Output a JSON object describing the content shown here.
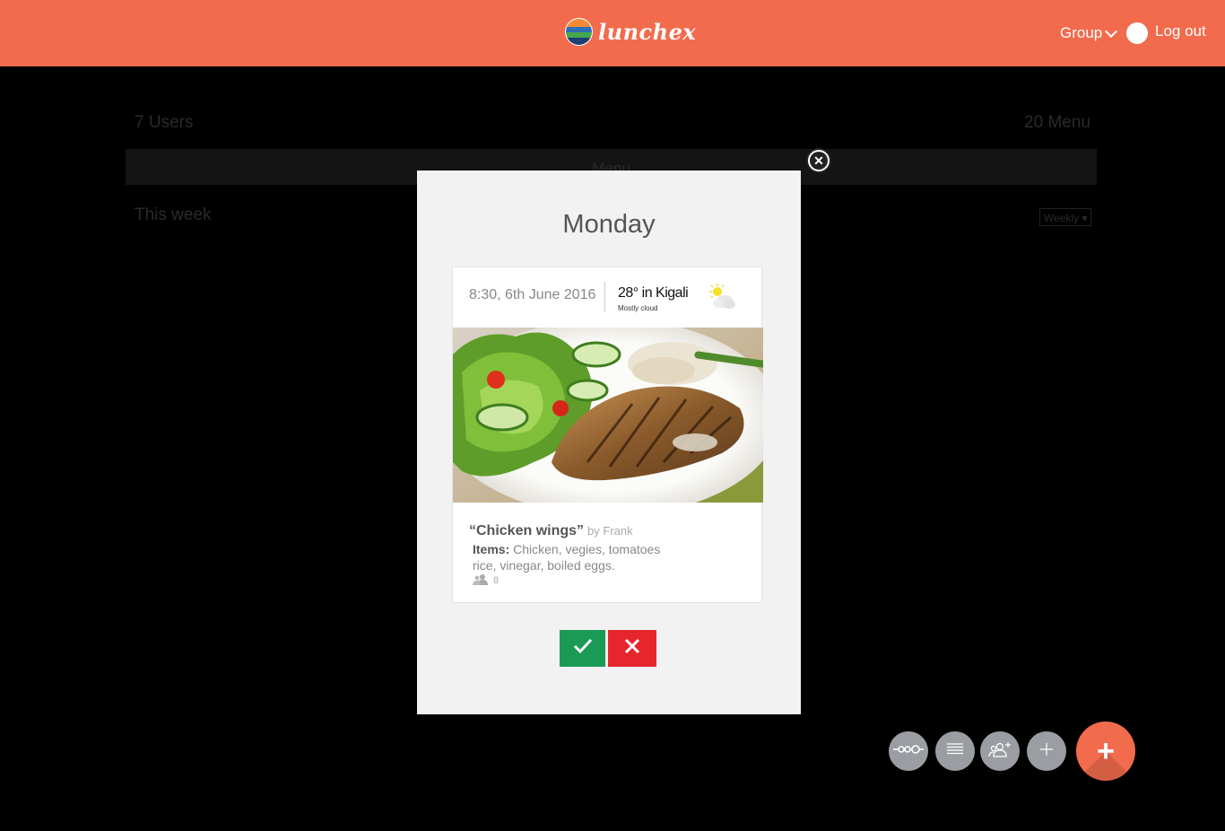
{
  "header": {
    "app_name": "lunchex",
    "group_label": "Group",
    "logout_label": "Log out"
  },
  "background_page": {
    "users_count": "7 Users",
    "menu_count": "20 Menu",
    "menu_bar_label": "Menu",
    "this_week_label": "This week",
    "period_select_value": "Weekly"
  },
  "modal": {
    "day_title": "Monday",
    "card": {
      "datetime": "8:30, 6th June 2016",
      "temperature": "28° in Kigali",
      "weather_desc": "Mostly cloud",
      "weather_icon": "partly-sunny-icon",
      "dish_name": "“Chicken wings”",
      "author": "by Frank",
      "items_label": "Items:",
      "items_text": "Chicken, vegies, tomatoes rice, vinegar, boiled eggs.",
      "people_count": "8"
    },
    "accept_icon": "check-icon",
    "reject_icon": "x-icon"
  },
  "fabs": [
    {
      "icon": "timeline-icon"
    },
    {
      "icon": "list-icon"
    },
    {
      "icon": "add-group-icon"
    },
    {
      "icon": "plus-icon"
    }
  ],
  "main_fab_label": "+",
  "colors": {
    "brand": "#f26b4d",
    "accept": "#1a9a55",
    "reject": "#e5262c",
    "fab_grey": "#9a9ea3"
  }
}
